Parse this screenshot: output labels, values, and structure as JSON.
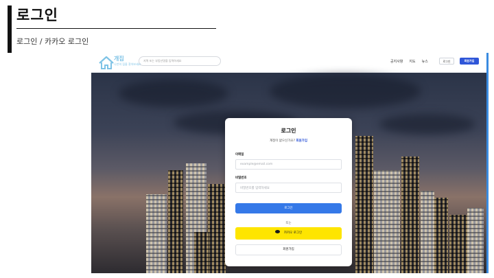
{
  "slide": {
    "title": "로그인",
    "breadcrumb": "로그인 / 카카오 로그인"
  },
  "nav": {
    "logo_text": "개집",
    "logo_sub": "나만의 집을 찾아보세요",
    "search_placeholder": "지역 또는 부동산명을 입력하세요",
    "links": [
      "공지사항",
      "지도",
      "뉴스"
    ],
    "login_label": "로그인",
    "signup_label": "회원가입"
  },
  "card": {
    "title": "로그인",
    "prompt": "계정이 없으신가요?",
    "prompt_link": "회원가입",
    "email_label": "이메일",
    "email_placeholder": "example@email.com",
    "password_label": "비밀번호",
    "password_placeholder": "비밀번호를 입력하세요",
    "login_button": "로그인",
    "or_text": "또는",
    "kakao_button": "카카오 로그인",
    "signup_button": "회원가입"
  },
  "colors": {
    "primary": "#2f56d8",
    "login_button": "#3579e8",
    "kakao": "#fee500",
    "logo": "#7ec3e6"
  },
  "icons": [
    "house-logo-icon",
    "kakao-chat-icon"
  ]
}
